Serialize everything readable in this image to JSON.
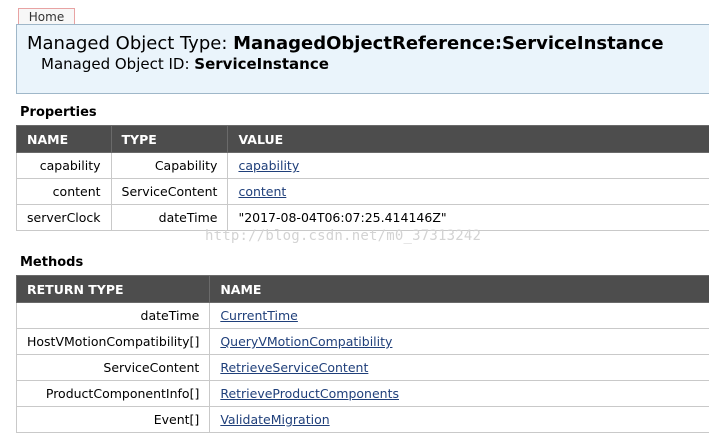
{
  "nav": {
    "home_label": "Home"
  },
  "header": {
    "type_label": "Managed Object Type: ",
    "type_value": "ManagedObjectReference:ServiceInstance",
    "id_label": "Managed Object ID: ",
    "id_value": "ServiceInstance"
  },
  "properties": {
    "title": "Properties",
    "columns": [
      "NAME",
      "TYPE",
      "VALUE"
    ],
    "rows": [
      {
        "name": "capability",
        "type": "Capability",
        "value": "capability"
      },
      {
        "name": "content",
        "type": "ServiceContent",
        "value": "content"
      },
      {
        "name": "serverClock",
        "type": "dateTime",
        "value": "\"2017-08-04T06:07:25.414146Z\""
      }
    ]
  },
  "methods": {
    "title": "Methods",
    "columns": [
      "RETURN TYPE",
      "NAME"
    ],
    "rows": [
      {
        "return_type": "dateTime",
        "name": "CurrentTime"
      },
      {
        "return_type": "HostVMotionCompatibility[]",
        "name": "QueryVMotionCompatibility"
      },
      {
        "return_type": "ServiceContent",
        "name": "RetrieveServiceContent"
      },
      {
        "return_type": "ProductComponentInfo[]",
        "name": "RetrieveProductComponents"
      },
      {
        "return_type": "Event[]",
        "name": "ValidateMigration"
      }
    ]
  },
  "watermark": "http://blog.csdn.net/m0_37313242"
}
